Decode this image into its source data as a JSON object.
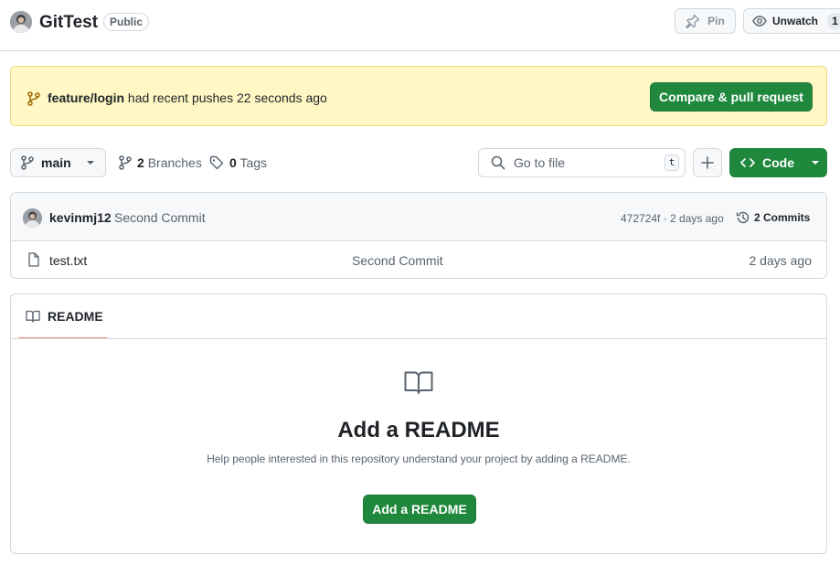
{
  "repo": {
    "name": "GitTest",
    "visibility": "Public",
    "pin_label": "Pin",
    "unwatch_label": "Unwatch",
    "watch_count": "1"
  },
  "banner": {
    "branch": "feature/login",
    "message": " had recent pushes 22 seconds ago",
    "button_label": "Compare & pull request"
  },
  "toolbar": {
    "branch_name": "main",
    "branches_count": "2",
    "branches_label": "Branches",
    "tags_count": "0",
    "tags_label": "Tags",
    "goto_placeholder": "Go to file",
    "goto_shortcut": "t",
    "code_label": "Code"
  },
  "latest_commit": {
    "author": "kevinmj12",
    "message": "Second Commit",
    "meta": "472724f · 2 days ago",
    "commits_label": "2 Commits"
  },
  "files": [
    {
      "name": "test.txt",
      "commit": "Second Commit",
      "date": "2 days ago"
    }
  ],
  "readme": {
    "tab_label": "README",
    "title": "Add a README",
    "description": "Help people interested in this repository understand your project by adding a README.",
    "button_label": "Add a README"
  },
  "colors": {
    "primary_green": "#1f883d",
    "banner_bg": "#fff8c5",
    "tab_underline": "#fd8c73",
    "border": "#d1d9e0"
  },
  "icons": [
    "repo-avatar",
    "pin-icon",
    "eye-icon",
    "git-branch-icon",
    "triangle-down-icon",
    "tag-icon",
    "search-icon",
    "plus-icon",
    "code-icon",
    "history-icon",
    "file-icon",
    "book-icon"
  ]
}
